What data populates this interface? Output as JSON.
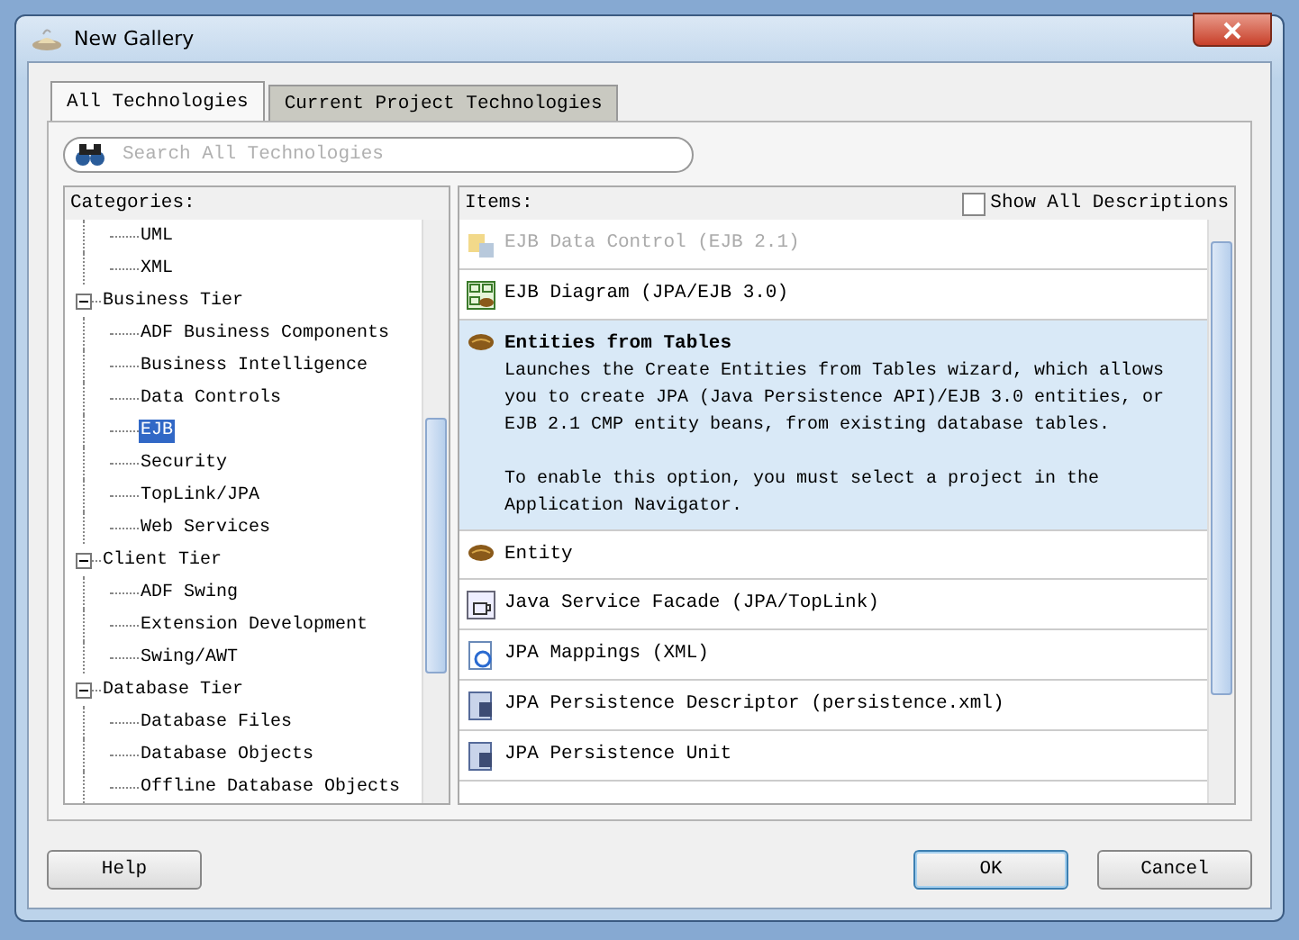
{
  "window": {
    "title": "New Gallery"
  },
  "tabs": [
    {
      "label": "All Technologies",
      "selected": true
    },
    {
      "label": "Current Project Technologies",
      "selected": false
    }
  ],
  "search": {
    "placeholder": "Search All Technologies"
  },
  "categories": {
    "label": "Categories:",
    "tree": [
      {
        "children": [
          {
            "label": "UML",
            "selected": false
          },
          {
            "label": "XML",
            "selected": false
          }
        ]
      },
      {
        "label": "Business Tier",
        "expanded": true,
        "selected": false,
        "children": [
          {
            "label": "ADF Business Components",
            "selected": false
          },
          {
            "label": "Business Intelligence",
            "selected": false
          },
          {
            "label": "Data Controls",
            "selected": false
          },
          {
            "label": "EJB",
            "selected": true
          },
          {
            "label": "Security",
            "selected": false
          },
          {
            "label": "TopLink/JPA",
            "selected": false
          },
          {
            "label": "Web Services",
            "selected": false
          }
        ]
      },
      {
        "label": "Client Tier",
        "expanded": true,
        "selected": false,
        "children": [
          {
            "label": "ADF Swing",
            "selected": false
          },
          {
            "label": "Extension Development",
            "selected": false
          },
          {
            "label": "Swing/AWT",
            "selected": false
          }
        ]
      },
      {
        "label": "Database Tier",
        "expanded": true,
        "selected": false,
        "children": [
          {
            "label": "Database Files",
            "selected": false
          },
          {
            "label": "Database Objects",
            "selected": false
          },
          {
            "label": "Offline Database Objects",
            "selected": false
          }
        ]
      }
    ]
  },
  "items": {
    "label": "Items:",
    "show_all_descriptions": {
      "label": "Show All Descriptions",
      "checked": false
    },
    "list": [
      {
        "kind": "data-control",
        "label": "EJB Data Control (EJB 2.1)",
        "disabled": true,
        "selected": false
      },
      {
        "kind": "diagram",
        "label": "EJB Diagram (JPA/EJB 3.0)",
        "disabled": false,
        "selected": false
      },
      {
        "kind": "bean",
        "label": "Entities from Tables",
        "disabled": false,
        "selected": true,
        "description": [
          "Launches the Create Entities from Tables wizard, which allows you to create JPA (Java Persistence API)/EJB 3.0 entities, or EJB 2.1 CMP entity beans, from existing database tables.",
          "To enable this option, you must select a project in the Application Navigator."
        ]
      },
      {
        "kind": "bean",
        "label": "Entity",
        "disabled": false,
        "selected": false
      },
      {
        "kind": "facade",
        "label": "Java Service Facade (JPA/TopLink)",
        "disabled": false,
        "selected": false
      },
      {
        "kind": "mappings",
        "label": "JPA Mappings (XML)",
        "disabled": false,
        "selected": false
      },
      {
        "kind": "descriptor",
        "label": "JPA Persistence Descriptor (persistence.xml)",
        "disabled": false,
        "selected": false
      },
      {
        "kind": "descriptor",
        "label": "JPA Persistence Unit",
        "disabled": false,
        "selected": false
      }
    ]
  },
  "buttons": [
    {
      "label": "Help"
    },
    {
      "label": "OK",
      "default": true
    },
    {
      "label": "Cancel",
      "default": false
    }
  ]
}
